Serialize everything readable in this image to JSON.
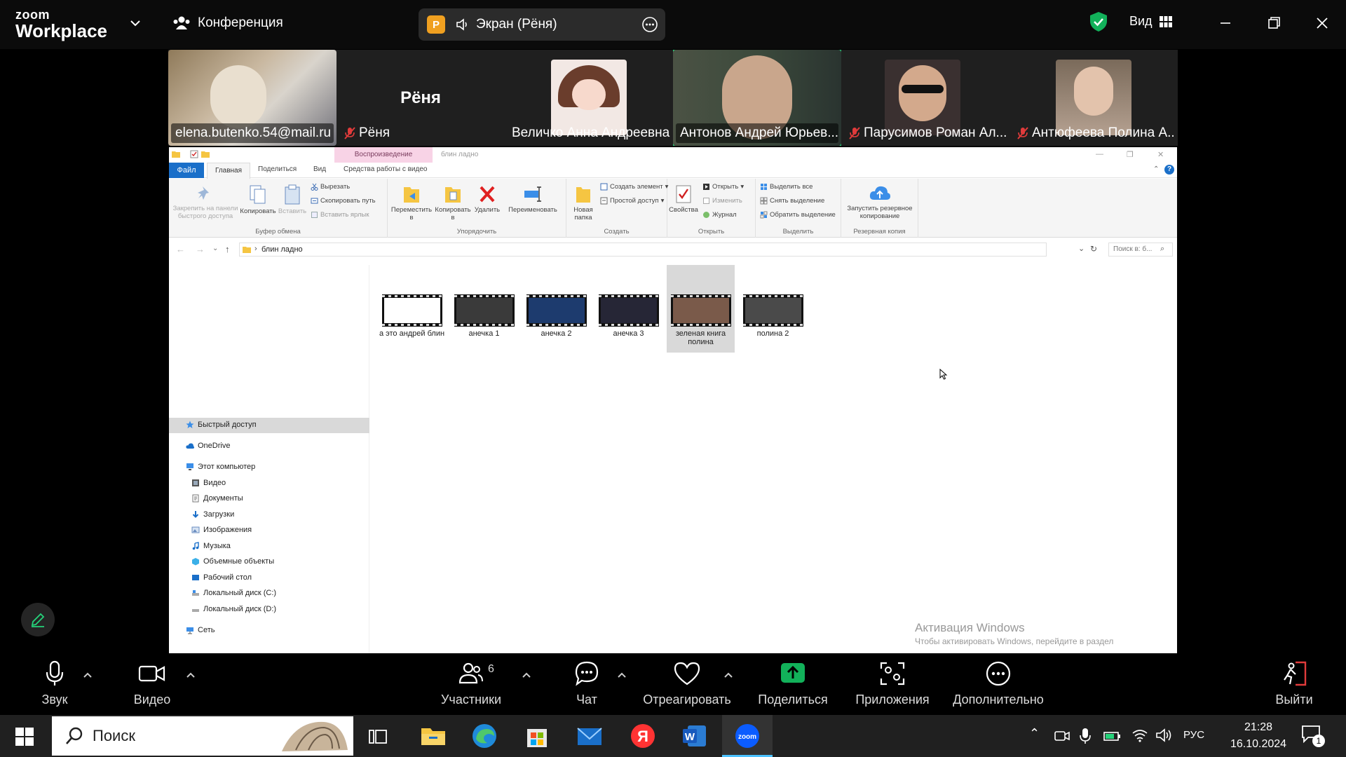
{
  "zoom": {
    "logo_line1": "zoom",
    "logo_line2": "Workplace",
    "meeting_label": "Конференция",
    "share_badge": "Р",
    "share_label": "Экран (Рёня)",
    "view_label": "Вид"
  },
  "participants": [
    {
      "name": "elena.butenko.54@mail.ru",
      "muted": false
    },
    {
      "name": "Рёня",
      "muted": true,
      "video_off_label": "Рёня"
    },
    {
      "name": "Величко Анна Андреевна",
      "muted": false
    },
    {
      "name": "Антонов Андрей Юрьев...",
      "muted": false,
      "active_speaker": true
    },
    {
      "name": "Парусимов Роман Ал...",
      "muted": true
    },
    {
      "name": "Антюфеева Полина А...",
      "muted": true
    }
  ],
  "explorer": {
    "context_tab": "Воспроизведение",
    "window_title": "блин ладно",
    "tabs": {
      "file": "Файл",
      "home": "Главная",
      "share": "Поделиться",
      "view": "Вид",
      "video_tools": "Средства работы с видео"
    },
    "ribbon": {
      "pin": "Закрепить на панели быстрого доступа",
      "copy": "Копировать",
      "paste": "Вставить",
      "cut": "Вырезать",
      "copy_path": "Скопировать путь",
      "paste_shortcut": "Вставить ярлык",
      "group_clipboard": "Буфер обмена",
      "move_to": "Переместить в",
      "copy_to": "Копировать в",
      "delete": "Удалить",
      "rename": "Переименовать",
      "group_organize": "Упорядочить",
      "new_folder": "Новая папка",
      "new_item": "Создать элемент",
      "easy_access": "Простой доступ",
      "group_new": "Создать",
      "properties": "Свойства",
      "open": "Открыть",
      "edit": "Изменить",
      "history": "Журнал",
      "group_open": "Открыть",
      "select_all": "Выделить все",
      "select_none": "Снять выделение",
      "invert": "Обратить выделение",
      "group_select": "Выделить",
      "backup": "Запустить резервное копирование",
      "group_backup": "Резервная копия"
    },
    "address_path": "блин ладно",
    "search_placeholder": "Поиск в: б...",
    "nav": {
      "quick_access": "Быстрый доступ",
      "onedrive": "OneDrive",
      "this_pc": "Этот компьютер",
      "items": [
        "Видео",
        "Документы",
        "Загрузки",
        "Изображения",
        "Музыка",
        "Объемные объекты",
        "Рабочий стол",
        "Локальный диск (C:)",
        "Локальный диск (D:)"
      ],
      "network": "Сеть"
    },
    "files": [
      {
        "name": "а это андрей блин",
        "thumb": "#ffffff"
      },
      {
        "name": "анечка 1",
        "thumb": "#3a3a3a"
      },
      {
        "name": "анечка 2",
        "thumb": "#1d3b6e"
      },
      {
        "name": "анечка 3",
        "thumb": "#262636"
      },
      {
        "name": "зеленая книга полина",
        "thumb": "#7a5a4a",
        "selected": true
      },
      {
        "name": "полина 2",
        "thumb": "#4a4a4a"
      }
    ],
    "activation_title": "Активация Windows",
    "activation_sub": "Чтобы активировать Windows, перейдите в раздел"
  },
  "toolbar": {
    "audio": "Звук",
    "video": "Видео",
    "participants": "Участники",
    "participants_count": "6",
    "chat": "Чат",
    "react": "Отреагировать",
    "share": "Поделиться",
    "apps": "Приложения",
    "more": "Дополнительно",
    "leave": "Выйти"
  },
  "taskbar": {
    "search_placeholder": "Поиск",
    "lang": "РУС",
    "time": "21:28",
    "date": "16.10.2024",
    "notification_count": "1"
  },
  "colors": {
    "accent_green": "#25d37a",
    "share_green": "#12b15a",
    "explorer_blue": "#1a6fc9",
    "context_pink": "#f8d3e6"
  }
}
